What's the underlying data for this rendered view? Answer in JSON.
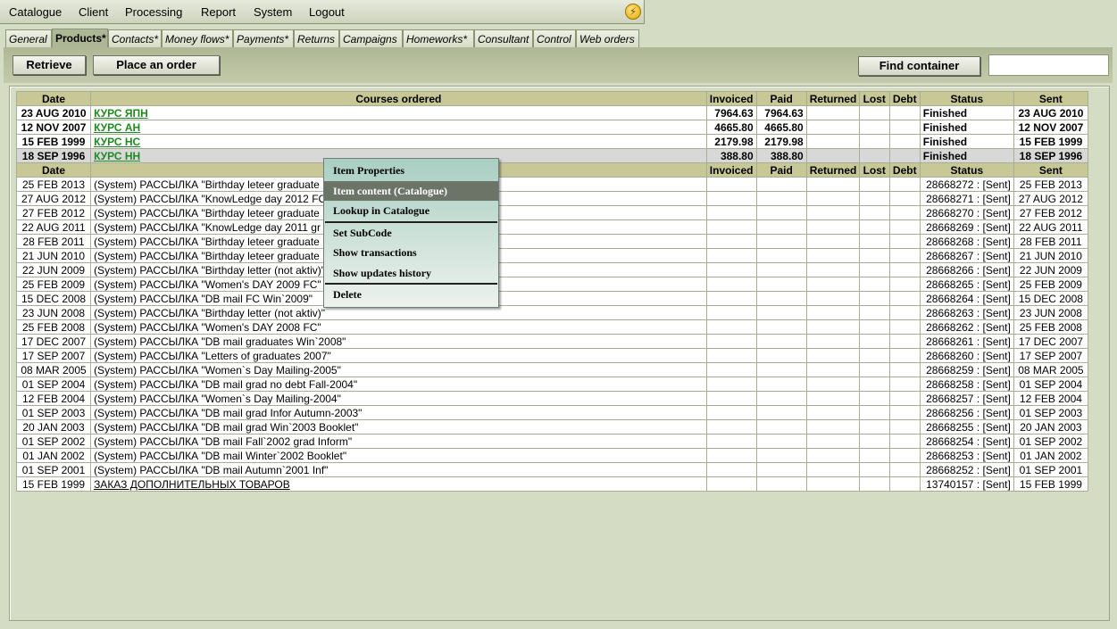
{
  "menu": {
    "items": [
      "Catalogue",
      "Client",
      "Processing",
      "Report",
      "System",
      "Logout"
    ]
  },
  "tabs": [
    "General",
    "Products*",
    "Contacts*",
    "Money flows*",
    "Payments*",
    "Returns",
    "Campaigns",
    "Homeworks*",
    "Consultant",
    "Control",
    "Web orders"
  ],
  "toolbar": {
    "retrieve_label": "Retrieve",
    "order_label": "Place an order",
    "find_label": "Find container",
    "find_value": ""
  },
  "orders_headers": [
    "Date",
    "Courses ordered",
    "Invoiced",
    "Paid",
    "Returned",
    "Lost",
    "Debt",
    "Status",
    "Sent"
  ],
  "orders": [
    {
      "date": "23 AUG 2010",
      "course": "КУРС ЯПН",
      "invoiced": "7964.63",
      "paid": "7964.63",
      "returned": "",
      "lost": "",
      "debt": "",
      "status": "Finished",
      "sent": "23 AUG 2010"
    },
    {
      "date": "12 NOV 2007",
      "course": "КУРС АН",
      "invoiced": "4665.80",
      "paid": "4665.80",
      "returned": "",
      "lost": "",
      "debt": "",
      "status": "Finished",
      "sent": "12 NOV 2007"
    },
    {
      "date": "15 FEB 1999",
      "course": "КУРС НС",
      "invoiced": "2179.98",
      "paid": "2179.98",
      "returned": "",
      "lost": "",
      "debt": "",
      "status": "Finished",
      "sent": "15 FEB 1999"
    },
    {
      "date": "18 SEP 1996",
      "course": "КУРС НН",
      "invoiced": "388.80",
      "paid": "388.80",
      "returned": "",
      "lost": "",
      "debt": "",
      "status": "Finished",
      "sent": "18 SEP 1996"
    }
  ],
  "items_headers": [
    "Date",
    "",
    "Invoiced",
    "Paid",
    "Returned",
    "Lost",
    "Debt",
    "Status",
    "Sent"
  ],
  "items": [
    {
      "date": "25 FEB 2013",
      "desc": "(System) РАССЫЛКА \"Birthday leteer graduate",
      "status": "28668272 : [Sent]",
      "sent": "25 FEB 2013"
    },
    {
      "date": "27 AUG 2012",
      "desc": "(System) РАССЫЛКА \"KnowLedge day 2012 FC",
      "status": "28668271 : [Sent]",
      "sent": "27 AUG 2012"
    },
    {
      "date": "27 FEB 2012",
      "desc": "(System) РАССЫЛКА \"Birthday leteer graduate",
      "status": "28668270 : [Sent]",
      "sent": "27 FEB 2012"
    },
    {
      "date": "22 AUG 2011",
      "desc": "(System) РАССЫЛКА \"KnowLedge day 2011 gr",
      "status": "28668269 : [Sent]",
      "sent": "22 AUG 2011"
    },
    {
      "date": "28 FEB 2011",
      "desc": "(System) РАССЫЛКА \"Birthday leteer graduate",
      "status": "28668268 : [Sent]",
      "sent": "28 FEB 2011"
    },
    {
      "date": "21 JUN 2010",
      "desc": "(System) РАССЫЛКА \"Birthday leteer graduate",
      "status": "28668267 : [Sent]",
      "sent": "21 JUN 2010"
    },
    {
      "date": "22 JUN 2009",
      "desc": "(System) РАССЫЛКА \"Birthday letter (not aktiv)\"",
      "status": "28668266 : [Sent]",
      "sent": "22 JUN 2009"
    },
    {
      "date": "25 FEB 2009",
      "desc": "(System) РАССЫЛКА \"Women's DAY 2009 FC\"",
      "status": "28668265 : [Sent]",
      "sent": "25 FEB 2009"
    },
    {
      "date": "15 DEC 2008",
      "desc": "(System) РАССЫЛКА \"DB mail FC Win`2009\"",
      "status": "28668264 : [Sent]",
      "sent": "15 DEC 2008"
    },
    {
      "date": "23 JUN 2008",
      "desc": "(System) РАССЫЛКА \"Birthday letter (not aktiv)\"",
      "status": "28668263 : [Sent]",
      "sent": "23 JUN 2008"
    },
    {
      "date": "25 FEB 2008",
      "desc": "(System) РАССЫЛКА \"Women's DAY 2008 FC\"",
      "status": "28668262 : [Sent]",
      "sent": "25 FEB 2008"
    },
    {
      "date": "17 DEC 2007",
      "desc": "(System) РАССЫЛКА \"DB mail graduates Win`2008\"",
      "status": "28668261 : [Sent]",
      "sent": "17 DEC 2007"
    },
    {
      "date": "17 SEP 2007",
      "desc": "(System) РАССЫЛКА \"Letters of graduates 2007\"",
      "status": "28668260 : [Sent]",
      "sent": "17 SEP 2007"
    },
    {
      "date": "08 MAR 2005",
      "desc": "(System) РАССЫЛКА \"Women`s Day Mailing-2005\"",
      "status": "28668259 : [Sent]",
      "sent": "08 MAR 2005"
    },
    {
      "date": "01 SEP 2004",
      "desc": "(System) РАССЫЛКА \"DB mail grad no debt Fall-2004\"",
      "status": "28668258 : [Sent]",
      "sent": "01 SEP 2004"
    },
    {
      "date": "12 FEB 2004",
      "desc": "(System) РАССЫЛКА \"Women`s Day Mailing-2004\"",
      "status": "28668257 : [Sent]",
      "sent": "12 FEB 2004"
    },
    {
      "date": "01 SEP 2003",
      "desc": "(System) РАССЫЛКА \"DB mail grad Infor Autumn-2003\"",
      "status": "28668256 : [Sent]",
      "sent": "01 SEP 2003"
    },
    {
      "date": "20 JAN 2003",
      "desc": "(System) РАССЫЛКА \"DB mail grad Win`2003 Booklet\"",
      "status": "28668255 : [Sent]",
      "sent": "20 JAN 2003"
    },
    {
      "date": "01 SEP 2002",
      "desc": "(System) РАССЫЛКА \"DB mail Fall`2002 grad Inform\"",
      "status": "28668254 : [Sent]",
      "sent": "01 SEP 2002"
    },
    {
      "date": "01 JAN 2002",
      "desc": "(System) РАССЫЛКА \"DB mail Winter`2002 Booklet\"",
      "status": "28668253 : [Sent]",
      "sent": "01 JAN 2002"
    },
    {
      "date": "01 SEP 2001",
      "desc": "(System) РАССЫЛКА \"DB mail Autumn`2001 Inf\"",
      "status": "28668252 : [Sent]",
      "sent": "01 SEP 2001"
    },
    {
      "date": "15 FEB 1999",
      "desc": "ЗАКАЗ ДОПОЛНИТЕЛЬНЫХ ТОВАРОВ",
      "status": "13740157 : [Sent]",
      "sent": "15 FEB 1999",
      "link": true
    }
  ],
  "context_menu": {
    "items": [
      "Item Properties",
      "Item content (Catalogue)",
      "Lookup in Catalogue",
      "Set SubCode",
      "Show transactions",
      "Show updates history",
      "Delete"
    ],
    "highlighted": 1
  },
  "icons": {
    "status": "lightning-icon"
  }
}
